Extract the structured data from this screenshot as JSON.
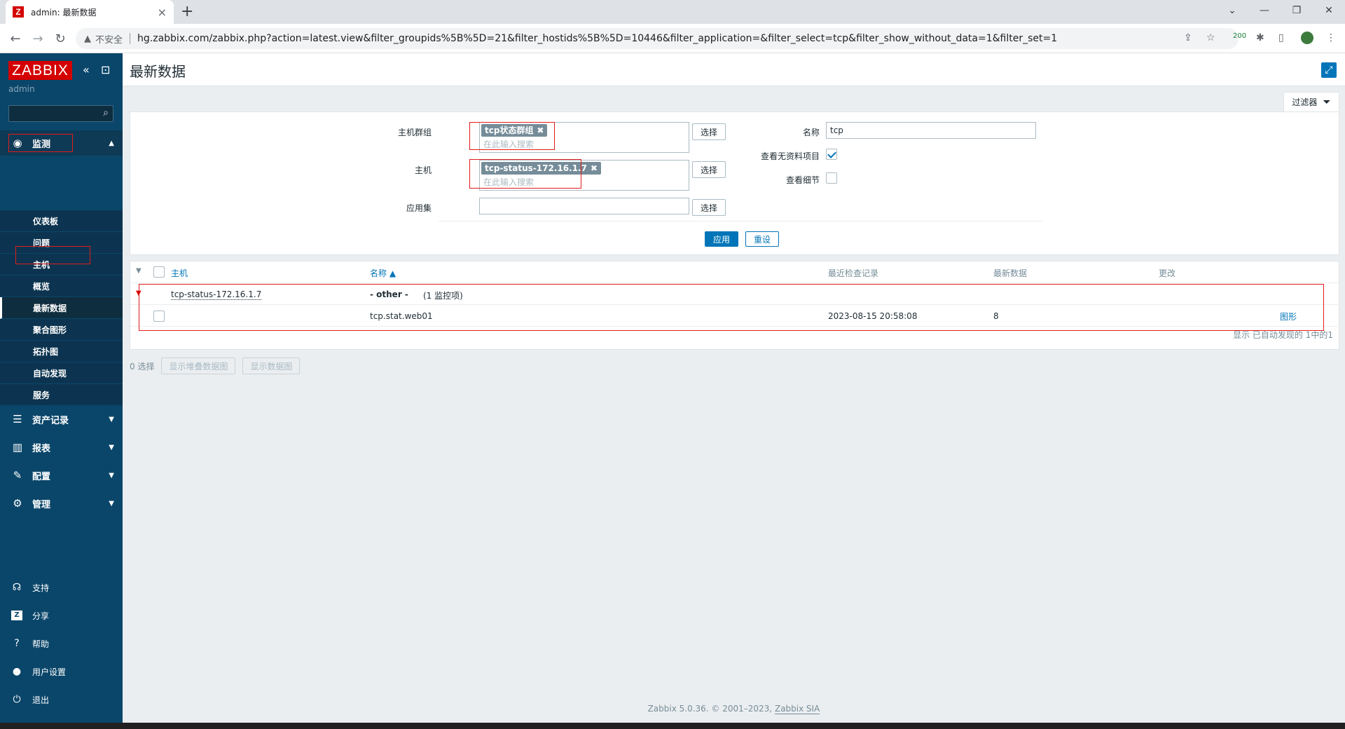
{
  "browser": {
    "tab_title": "admin: 最新数据",
    "tab_favicon": "Z",
    "insecure_label": "不安全",
    "url": "hg.zabbix.com/zabbix.php?action=latest.view&filter_groupids%5B%5D=21&filter_hostids%5B%5D=10446&filter_application=&filter_select=tcp&filter_show_without_data=1&filter_set=1",
    "extension_badge": "200"
  },
  "sidebar": {
    "logo": "ZABBIX",
    "user": "admin",
    "sections": {
      "monitoring": "监测",
      "inventory": "资产记录",
      "reports": "报表",
      "configuration": "配置",
      "administration": "管理"
    },
    "monitoring_items": [
      "仪表板",
      "问题",
      "主机",
      "概览",
      "最新数据",
      "聚合图形",
      "拓扑图",
      "自动发现",
      "服务"
    ],
    "bottom": {
      "support": "支持",
      "share": "分享",
      "help": "帮助",
      "user_settings": "用户设置",
      "logout": "退出"
    }
  },
  "page": {
    "title": "最新数据",
    "filter_tab": "过滤器"
  },
  "filter": {
    "host_groups_label": "主机群组",
    "host_group_chip": "tcp状态群组",
    "hosts_label": "主机",
    "host_chip": "tcp-status-172.16.1.7",
    "search_placeholder": "在此输入搜索",
    "application_label": "应用集",
    "select_button": "选择",
    "name_label": "名称",
    "name_value": "tcp",
    "show_without_data_label": "查看无资料项目",
    "show_without_data": true,
    "show_details_label": "查看细节",
    "show_details": false,
    "apply_button": "应用",
    "reset_button": "重设"
  },
  "table": {
    "headers": {
      "host": "主机",
      "name": "名称 ▲",
      "last_check": "最近检查记录",
      "last_value": "最新数据",
      "change": "更改"
    },
    "group_row": {
      "host": "tcp-status-172.16.1.7",
      "app_prefix": "- other -",
      "app_count": "(1 监控项)"
    },
    "rows": [
      {
        "name": "tcp.stat.web01",
        "last_check": "2023-08-15 20:58:08",
        "last_value": "8",
        "change": "",
        "link": "图形"
      }
    ],
    "paging": "显示 已自动发现的 1中的1"
  },
  "actions": {
    "selected_count": "0 选择",
    "stacked_graph_button": "显示堆叠数据图",
    "graph_button": "显示数据图"
  },
  "footer": {
    "text": "Zabbix 5.0.36. © 2001–2023, ",
    "link": "Zabbix SIA"
  },
  "colors": {
    "sidebar_bg": "#0a466a",
    "brand_red": "#d40000",
    "accent_blue": "#0275b8",
    "annotation_red": "#e21c1c"
  }
}
